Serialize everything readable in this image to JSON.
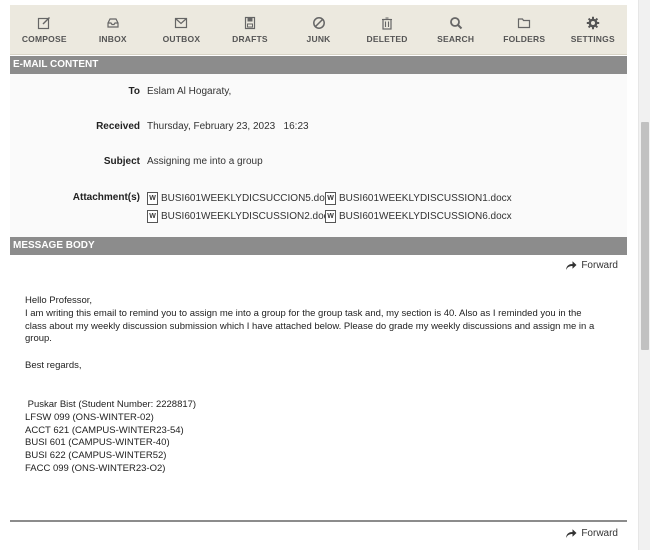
{
  "toolbar": {
    "items": [
      {
        "label": "COMPOSE",
        "icon": "compose-icon"
      },
      {
        "label": "INBOX",
        "icon": "inbox-icon"
      },
      {
        "label": "OUTBOX",
        "icon": "outbox-icon"
      },
      {
        "label": "DRAFTS",
        "icon": "drafts-icon"
      },
      {
        "label": "JUNK",
        "icon": "junk-icon"
      },
      {
        "label": "DELETED",
        "icon": "trash-icon"
      },
      {
        "label": "SEARCH",
        "icon": "search-icon"
      },
      {
        "label": "FOLDERS",
        "icon": "folder-icon"
      },
      {
        "label": "SETTINGS",
        "icon": "gear-icon"
      }
    ]
  },
  "email_content": {
    "section_title": "E-MAIL CONTENT",
    "to_label": "To",
    "to_value": "Eslam Al Hogaraty,",
    "received_label": "Received",
    "received_value": "Thursday, February 23, 2023   16:23",
    "subject_label": "Subject",
    "subject_value": "Assigning me into a group",
    "attachments_label": "Attachment(s)",
    "attachments": [
      "BUSI601WEEKLYDICSUCCION5.docx",
      "BUSI601WEEKLYDISCUSSION1.docx",
      "BUSI601WEEKLYDISCUSSION2.docx",
      "BUSI601WEEKLYDISCUSSION6.docx"
    ]
  },
  "message_body": {
    "section_title": "MESSAGE BODY",
    "forward_label": "Forward",
    "greeting": "Hello Professor,",
    "paragraph": "I am writing this email to remind you to assign me into a group for the group task and, my section is 40. Also as I reminded you in the class about my weekly discussion submission which I have attached below. Please do grade my weekly discussions and assign me in a group.",
    "closing": "Best regards,",
    "signature": [
      " Puskar Bist (Student Number: 2228817)",
      "LFSW 099 (ONS-WINTER-02)",
      "ACCT 621 (CAMPUS-WINTER23-54)",
      "BUSI 601 (CAMPUS-WINTER-40)",
      "BUSI 622 (CAMPUS-WINTER52)",
      "FACC 099 (ONS-WINTER23-O2)"
    ]
  },
  "colors": {
    "toolbar_bg": "#ece9df",
    "section_bar": "#8c8c8c",
    "header_bg": "#fafafa"
  }
}
